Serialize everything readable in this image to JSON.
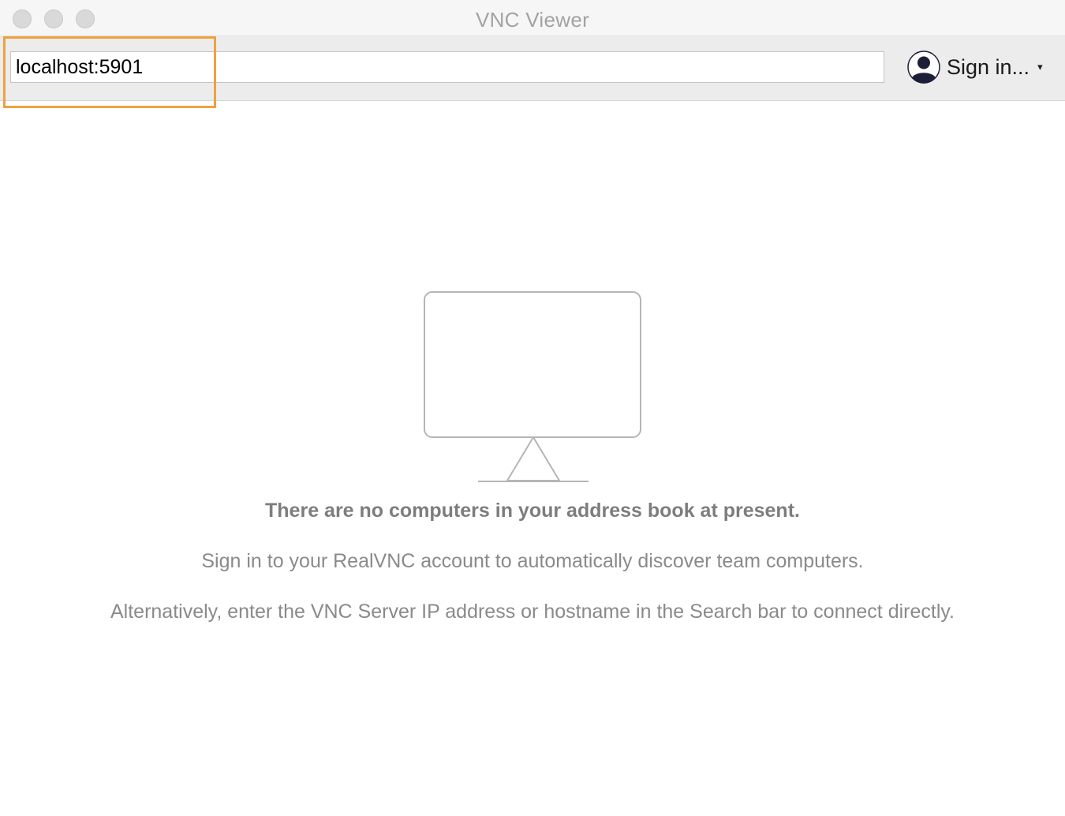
{
  "window": {
    "title": "VNC Viewer"
  },
  "toolbar": {
    "search_value": "localhost:5901",
    "signin_label": "Sign in...",
    "signin_caret": "▾"
  },
  "empty_state": {
    "heading": "There are no computers in your address book at present.",
    "line1": "Sign in to your RealVNC account to automatically discover team computers.",
    "line2": "Alternatively, enter the VNC Server IP address or hostname in the Search bar to connect directly."
  },
  "icons": {
    "monitor": "monitor-icon",
    "avatar": "user-avatar-icon"
  },
  "colors": {
    "highlight": "#f0a13e",
    "muted_text": "#8a8a8a"
  }
}
